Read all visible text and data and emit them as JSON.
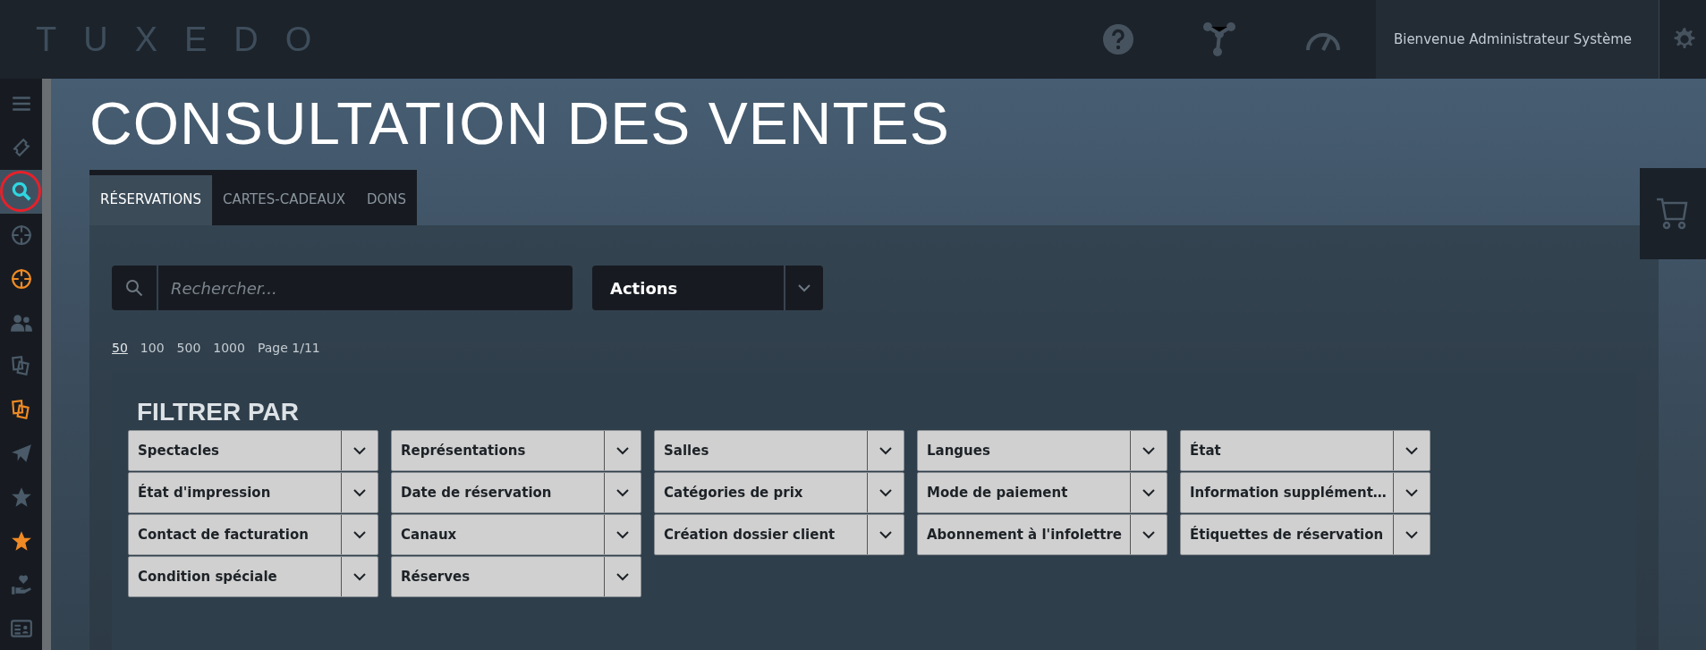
{
  "header": {
    "logo": "TUXEDO",
    "welcome": "Bienvenue Administrateur Système"
  },
  "sidebar": {
    "items": [
      {
        "kind": "menu",
        "color": "#4a5a68",
        "selected": false
      },
      {
        "kind": "ticket",
        "color": "#4a5a68",
        "selected": false
      },
      {
        "kind": "search",
        "color": "#2fd6e0",
        "selected": true
      },
      {
        "kind": "crosshair",
        "color": "#4a5a68",
        "selected": false
      },
      {
        "kind": "crosshair",
        "color": "#f08a24",
        "selected": false
      },
      {
        "kind": "users",
        "color": "#4a5a68",
        "selected": false
      },
      {
        "kind": "cards",
        "color": "#4a5a68",
        "selected": false
      },
      {
        "kind": "cards",
        "color": "#f08a24",
        "selected": false
      },
      {
        "kind": "plane",
        "color": "#4a5a68",
        "selected": false
      },
      {
        "kind": "star",
        "color": "#4a5a68",
        "selected": false
      },
      {
        "kind": "star",
        "color": "#f08a24",
        "selected": false
      },
      {
        "kind": "donate",
        "color": "#4a5a68",
        "selected": false
      },
      {
        "kind": "idcard",
        "color": "#4a5a68",
        "selected": false
      }
    ]
  },
  "title": "CONSULTATION DES VENTES",
  "tabs": [
    {
      "label": "RÉSERVATIONS",
      "selected": true
    },
    {
      "label": "CARTES-CADEAUX",
      "selected": false
    },
    {
      "label": "DONS",
      "selected": false
    }
  ],
  "search": {
    "placeholder": "Rechercher..."
  },
  "actions": {
    "label": "Actions"
  },
  "pagination": {
    "sizes": [
      {
        "label": "50",
        "selected": true
      },
      {
        "label": "100",
        "selected": false
      },
      {
        "label": "500",
        "selected": false
      },
      {
        "label": "1000",
        "selected": false
      }
    ],
    "page": "Page 1/11"
  },
  "filters": {
    "title": "FILTRER PAR",
    "items": [
      "Spectacles",
      "Représentations",
      "Salles",
      "Langues",
      "État",
      "État d'impression",
      "Date de réservation",
      "Catégories de prix",
      "Mode de paiement",
      "Information supplément…",
      "Contact de facturation",
      "Canaux",
      "Création dossier client",
      "Abonnement à l'infolettre",
      "Étiquettes de réservation",
      "Condition spéciale",
      "Réserves"
    ]
  }
}
